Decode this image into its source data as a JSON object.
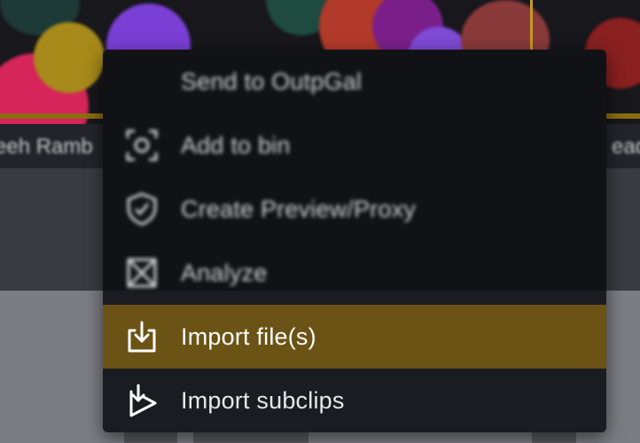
{
  "background": {
    "clip_labels": [
      "eeh Ramb",
      "ead"
    ]
  },
  "context_menu": {
    "items": [
      {
        "label": "Send to OutpGal",
        "icon": "none",
        "state": "disabled"
      },
      {
        "label": "Add to bin",
        "icon": "focus-frame-icon",
        "state": "disabled"
      },
      {
        "label": "Create Preview/Proxy",
        "icon": "shield-icon",
        "state": "disabled"
      },
      {
        "label": "Analyze",
        "icon": "analyze-icon",
        "state": "disabled"
      },
      {
        "label": "Import file(s)",
        "icon": "import-file-icon",
        "state": "highlighted"
      },
      {
        "label": "Import subclips",
        "icon": "import-subclips-icon",
        "state": "normal"
      }
    ]
  },
  "colors": {
    "menu_background": "#111216",
    "highlight": "#6b5315",
    "text": "#ffffff"
  }
}
